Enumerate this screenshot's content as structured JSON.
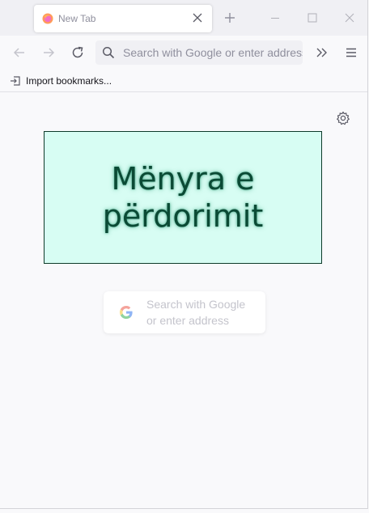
{
  "tab": {
    "title": "New Tab"
  },
  "toolbar": {
    "url_placeholder": "Search with Google or enter address"
  },
  "bookmarks": {
    "import_label": "Import bookmarks..."
  },
  "content": {
    "banner_line1": "Mënyra e",
    "banner_line2": "përdorimit",
    "search_line1": "Search with Google",
    "search_line2": "or enter address"
  },
  "icons": [
    "firefox-icon",
    "close-icon",
    "plus-icon",
    "minimize-icon",
    "maximize-icon",
    "back-icon",
    "forward-icon",
    "reload-icon",
    "search-icon",
    "overflow-icon",
    "hamburger-menu-icon",
    "import-icon",
    "gear-icon",
    "google-logo-icon"
  ],
  "colors": {
    "banner_bg": "#d7fdf3",
    "banner_text": "#0b4a35",
    "page_bg": "#f9f9fb"
  }
}
